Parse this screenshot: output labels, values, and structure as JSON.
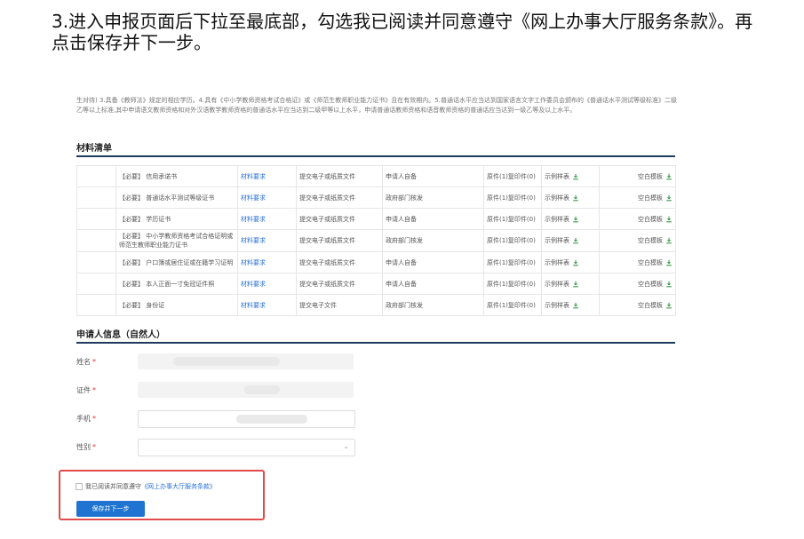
{
  "heading": {
    "num": "3.",
    "text": "进入申报页面后下拉至最底部，勾选我已阅读并同意遵守《网上办事大厅服务条款》。再点击保存并下一步。"
  },
  "intro": "生对待) 3.具备《教师法》规定的相应学历。4.具有《中小学教师资格考试合格证》或《师范生教师职业能力证书》且在有效期内。5.普通话水平应当达到国家语言文字工作委员会颁布的《普通话水平测试等级标准》二级乙等以上标准,其中申请语文教师资格和对外汉语教学教师资格的普通话水平应当达到二级甲等以上水平，申请普通话教师资格和语音教师资格的普通话应当达到一级乙等及以上水平。",
  "materials": {
    "title": "材料清单",
    "rows": [
      {
        "name": "【必要】 信用承诺书",
        "req": "材料要求",
        "type": "提交电子或纸质文件",
        "source": "申请人自备",
        "copies": "原件(1)复印件(0)",
        "sample": "示例样表",
        "blank": "空白模板"
      },
      {
        "name": "【必要】 普通话水平测试等级证书",
        "req": "材料要求",
        "type": "提交电子或纸质文件",
        "source": "政府部门核发",
        "copies": "原件(1)复印件(0)",
        "sample": "示例样表",
        "blank": "空白模板"
      },
      {
        "name": "【必要】 学历证书",
        "req": "材料要求",
        "type": "提交电子或纸质文件",
        "source": "申请人自备",
        "copies": "原件(1)复印件(0)",
        "sample": "示例样表",
        "blank": "空白模板"
      },
      {
        "name": "【必要】 中小学教师资格考试合格证明或师范生教师职业能力证书",
        "req": "材料要求",
        "type": "提交电子或纸质文件",
        "source": "政府部门核发",
        "copies": "原件(1)复印件(0)",
        "sample": "示例样表",
        "blank": "空白模板"
      },
      {
        "name": "【必要】 户口簿或居住证或在籍学习证明",
        "req": "材料要求",
        "type": "提交电子或纸质文件",
        "source": "申请人自备",
        "copies": "原件(1)复印件(0)",
        "sample": "示例样表",
        "blank": "空白模板"
      },
      {
        "name": "【必要】 本人正面一寸免冠证件照",
        "req": "材料要求",
        "type": "提交电子或纸质文件",
        "source": "申请人自备",
        "copies": "原件(1)复印件(0)",
        "sample": "示例样表",
        "blank": "空白模板"
      },
      {
        "name": "【必要】 身份证",
        "req": "材料要求",
        "type": "提交电子文件",
        "source": "政府部门核发",
        "copies": "原件(1)复印件(0)",
        "sample": "示例样表",
        "blank": "空白模板"
      }
    ]
  },
  "applicant": {
    "title": "申请人信息（自然人）",
    "fields": {
      "name": "姓名",
      "id": "证件",
      "phone": "手机",
      "gender": "性别"
    },
    "required_mark": "*"
  },
  "agree": {
    "text": "我已阅读并同意遵守",
    "link": "《网上办事大厅服务条款》"
  },
  "submit": "保存并下一步",
  "icons": {
    "download": "download-icon",
    "dropdown": "chevron-down-icon"
  },
  "colors": {
    "link": "#2a72d8",
    "button": "#1e74d0",
    "highlight": "#e24b4b",
    "required": "#e0322b"
  }
}
